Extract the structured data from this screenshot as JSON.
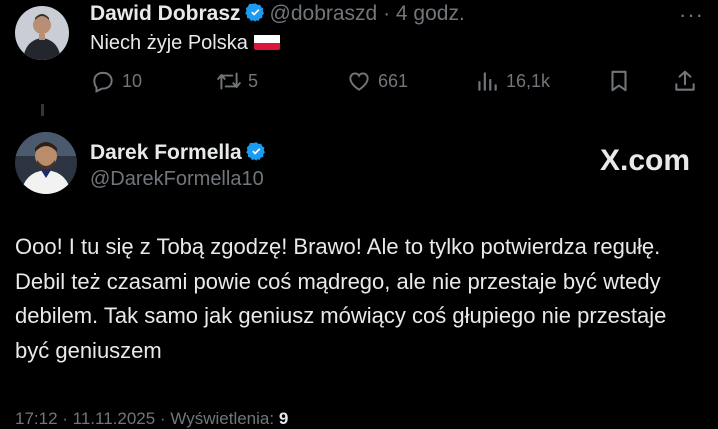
{
  "colors": {
    "background": "#000000",
    "text": "#e7e9ea",
    "muted": "#71767b",
    "verified": "#1d9bf0"
  },
  "tweet1": {
    "author_name": "Dawid Dobrasz",
    "handle": "@dobraszd",
    "time": "· 4 godz.",
    "text": "Niech żyje Polska",
    "flag_icon": "poland-flag",
    "more_icon": "more-dots-icon",
    "more_text": "···",
    "actions": {
      "reply_count": "10",
      "retweet_count": "5",
      "like_count": "661",
      "views_count": "16,1k"
    }
  },
  "tweet2": {
    "author_name": "Darek Formella",
    "handle": "@DarekFormella10",
    "brand": "X.com",
    "text": "Ooo! I tu się z Tobą zgodzę! Brawo! Ale to tylko potwierdza regułę. Debil też czasami powie coś mądrego, ale nie przestaje być wtedy debilem. Tak samo jak geniusz mówiący coś głupiego nie przestaje być geniuszem",
    "meta_prefix": "17:12 · 11.11.2025 · Wyświetlenia: ",
    "views": "9"
  }
}
